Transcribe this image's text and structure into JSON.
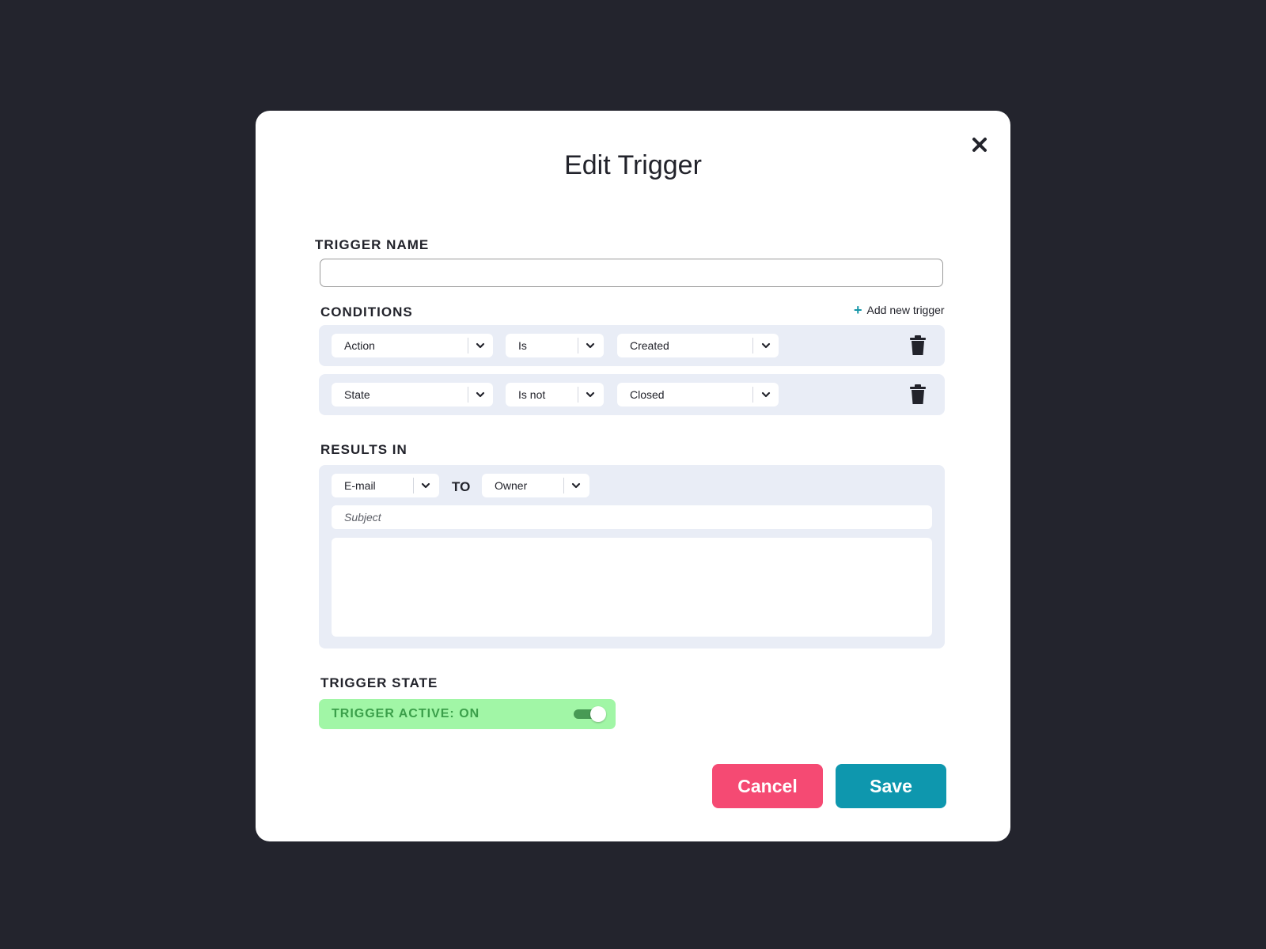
{
  "modal": {
    "title": "Edit Trigger",
    "close_icon": "close-icon"
  },
  "trigger_name": {
    "label": "TRIGGER NAME",
    "value": "",
    "placeholder": ""
  },
  "conditions": {
    "label": "CONDITIONS",
    "add_label": "Add new trigger",
    "add_icon": "plus-icon",
    "rows": [
      {
        "field": "Action",
        "operator": "Is",
        "value": "Created"
      },
      {
        "field": "State",
        "operator": "Is not",
        "value": "Closed"
      }
    ],
    "delete_icon": "trash-icon"
  },
  "results": {
    "label": "RESULTS IN",
    "channel": "E-mail",
    "to_label": "TO",
    "recipient": "Owner",
    "subject_placeholder": "Subject",
    "body": ""
  },
  "trigger_state": {
    "label": "TRIGGER STATE",
    "toggle_label": "TRIGGER ACTIVE: ON",
    "active": true
  },
  "buttons": {
    "cancel": "Cancel",
    "save": "Save"
  },
  "colors": {
    "backdrop": "#23242d",
    "accent": "#0e97ae",
    "cancel": "#f54a73",
    "active_bg": "#a1f6a6",
    "active_text": "#3b9f4a"
  }
}
